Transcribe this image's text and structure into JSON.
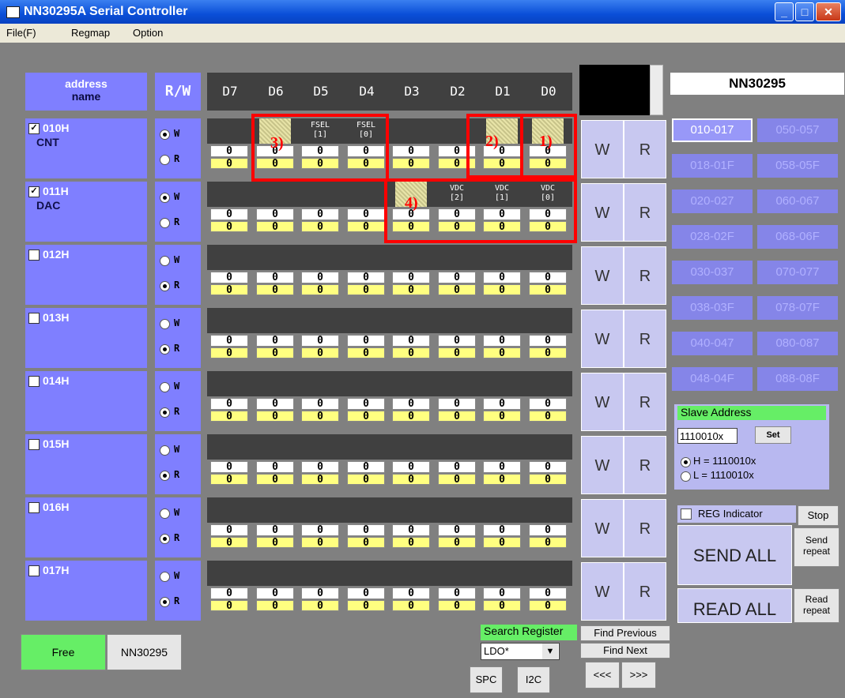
{
  "window": {
    "title": "NN30295A Serial Controller"
  },
  "menu": [
    "File(F)",
    "Regmap",
    "Option"
  ],
  "header": {
    "name_l1": "address",
    "name_l2": "name",
    "rw": "R/W",
    "bits": [
      "D7",
      "D6",
      "D5",
      "D4",
      "D3",
      "D2",
      "D1",
      "D0"
    ]
  },
  "chip_name": "NN30295",
  "registers": [
    {
      "checked": true,
      "addr": "010H",
      "name": "CNT",
      "mode": "W",
      "labels": [
        "",
        "",
        "FSEL\n[1]",
        "FSEL\n[0]",
        "",
        "",
        "",
        ""
      ],
      "write": [
        "0",
        "0",
        "0",
        "0",
        "0",
        "0",
        "0",
        "0"
      ],
      "read": [
        "0",
        "0",
        "0",
        "0",
        "0",
        "0",
        "0",
        "0"
      ]
    },
    {
      "checked": true,
      "addr": "011H",
      "name": "DAC",
      "mode": "W",
      "labels": [
        "",
        "",
        "",
        "",
        "",
        "VDC\n[2]",
        "VDC\n[1]",
        "VDC\n[0]"
      ],
      "write": [
        "0",
        "0",
        "0",
        "0",
        "0",
        "0",
        "0",
        "0"
      ],
      "read": [
        "0",
        "0",
        "0",
        "0",
        "0",
        "0",
        "0",
        "0"
      ]
    },
    {
      "checked": false,
      "addr": "012H",
      "name": "",
      "mode": "R",
      "labels": [
        "",
        "",
        "",
        "",
        "",
        "",
        "",
        ""
      ],
      "write": [
        "0",
        "0",
        "0",
        "0",
        "0",
        "0",
        "0",
        "0"
      ],
      "read": [
        "0",
        "0",
        "0",
        "0",
        "0",
        "0",
        "0",
        "0"
      ]
    },
    {
      "checked": false,
      "addr": "013H",
      "name": "",
      "mode": "R",
      "labels": [
        "",
        "",
        "",
        "",
        "",
        "",
        "",
        ""
      ],
      "write": [
        "0",
        "0",
        "0",
        "0",
        "0",
        "0",
        "0",
        "0"
      ],
      "read": [
        "0",
        "0",
        "0",
        "0",
        "0",
        "0",
        "0",
        "0"
      ]
    },
    {
      "checked": false,
      "addr": "014H",
      "name": "",
      "mode": "R",
      "labels": [
        "",
        "",
        "",
        "",
        "",
        "",
        "",
        ""
      ],
      "write": [
        "0",
        "0",
        "0",
        "0",
        "0",
        "0",
        "0",
        "0"
      ],
      "read": [
        "0",
        "0",
        "0",
        "0",
        "0",
        "0",
        "0",
        "0"
      ]
    },
    {
      "checked": false,
      "addr": "015H",
      "name": "",
      "mode": "R",
      "labels": [
        "",
        "",
        "",
        "",
        "",
        "",
        "",
        ""
      ],
      "write": [
        "0",
        "0",
        "0",
        "0",
        "0",
        "0",
        "0",
        "0"
      ],
      "read": [
        "0",
        "0",
        "0",
        "0",
        "0",
        "0",
        "0",
        "0"
      ]
    },
    {
      "checked": false,
      "addr": "016H",
      "name": "",
      "mode": "R",
      "labels": [
        "",
        "",
        "",
        "",
        "",
        "",
        "",
        ""
      ],
      "write": [
        "0",
        "0",
        "0",
        "0",
        "0",
        "0",
        "0",
        "0"
      ],
      "read": [
        "0",
        "0",
        "0",
        "0",
        "0",
        "0",
        "0",
        "0"
      ]
    },
    {
      "checked": false,
      "addr": "017H",
      "name": "",
      "mode": "R",
      "labels": [
        "",
        "",
        "",
        "",
        "",
        "",
        "",
        ""
      ],
      "write": [
        "0",
        "0",
        "0",
        "0",
        "0",
        "0",
        "0",
        "0"
      ],
      "read": [
        "0",
        "0",
        "0",
        "0",
        "0",
        "0",
        "0",
        "0"
      ]
    }
  ],
  "rw_labels": {
    "w": "W",
    "r": "R"
  },
  "row_buttons": {
    "write": "W",
    "read": "R"
  },
  "ranges": [
    "010-017",
    "050-057",
    "018-01F",
    "058-05F",
    "020-027",
    "060-067",
    "028-02F",
    "068-06F",
    "030-037",
    "070-077",
    "038-03F",
    "078-07F",
    "040-047",
    "080-087",
    "048-04F",
    "088-08F"
  ],
  "selected_range": "010-017",
  "slave": {
    "title": "Slave Address",
    "value": "1110010x",
    "set": "Set",
    "h": "H = 1110010x",
    "l": "L = 1110010x"
  },
  "reg_indicator": "REG Indicator",
  "stop": "Stop",
  "send_all": "SEND ALL",
  "send_repeat": "Send\nrepeat",
  "read_all": "READ ALL",
  "read_repeat": "Read\nrepeat",
  "free": "Free",
  "chip_btn": "NN30295",
  "search": {
    "label": "Search Register",
    "value": "LDO*"
  },
  "find_prev": "Find Previous",
  "find_next": "Find Next",
  "spc": "SPC",
  "i2c": "I2C",
  "nav_prev": "<<<",
  "nav_next": ">>>",
  "annotations": [
    "1)",
    "2)",
    "3)",
    "4)"
  ],
  "colors": {
    "panel": "#7f7fff",
    "accent_red": "#ff0000",
    "read_row": "#ffff80",
    "free_btn": "#66ee66"
  }
}
